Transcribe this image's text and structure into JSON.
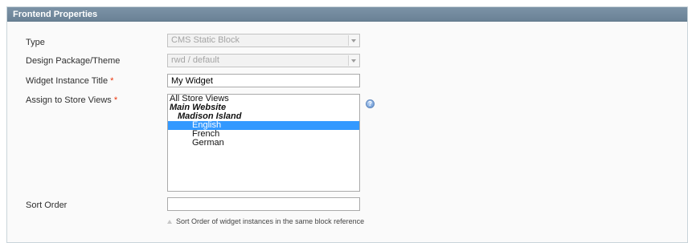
{
  "panel": {
    "title": "Frontend Properties"
  },
  "fields": {
    "type": {
      "label": "Type",
      "value": "CMS Static Block"
    },
    "design_theme": {
      "label": "Design Package/Theme",
      "value": "rwd / default"
    },
    "widget_title": {
      "label": "Widget Instance Title",
      "required_mark": "*",
      "value": "My Widget"
    },
    "store_views": {
      "label": "Assign to Store Views",
      "required_mark": "*",
      "options": [
        {
          "text": "All Store Views",
          "kind": "option"
        },
        {
          "text": "Main Website",
          "kind": "website"
        },
        {
          "text": "Madison Island",
          "kind": "store"
        },
        {
          "text": "English",
          "kind": "view",
          "selected": true
        },
        {
          "text": "French",
          "kind": "view"
        },
        {
          "text": "German",
          "kind": "view"
        }
      ],
      "help_icon": "question-icon"
    },
    "sort_order": {
      "label": "Sort Order",
      "value": "",
      "note": "Sort Order of widget instances in the same block reference"
    }
  },
  "colors": {
    "header_bg": "#6f879b",
    "selected_bg": "#3399ff",
    "required": "#eb340a"
  }
}
